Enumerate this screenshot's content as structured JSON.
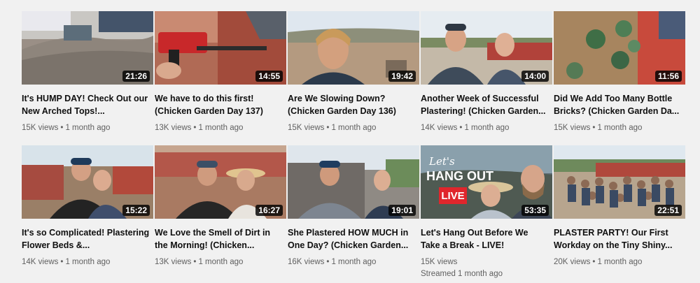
{
  "videos": [
    {
      "title": "It's HUMP DAY! Check Out our New Arched Tops!...",
      "duration": "21:26",
      "views": "15K views",
      "age": "1 month ago"
    },
    {
      "title": "We have to do this first! (Chicken Garden Day 137)",
      "duration": "14:55",
      "views": "13K views",
      "age": "1 month ago"
    },
    {
      "title": "Are We Slowing Down? (Chicken Garden Day 136)",
      "duration": "19:42",
      "views": "15K views",
      "age": "1 month ago"
    },
    {
      "title": "Another Week of Successful Plastering! (Chicken Garden...",
      "duration": "14:00",
      "views": "14K views",
      "age": "1 month ago"
    },
    {
      "title": "Did We Add Too Many Bottle Bricks? (Chicken Garden Da...",
      "duration": "11:56",
      "views": "15K views",
      "age": "1 month ago"
    },
    {
      "title": "It's so Complicated! Plastering Flower Beds &...",
      "duration": "15:22",
      "views": "14K views",
      "age": "1 month ago"
    },
    {
      "title": "We Love the Smell of Dirt in the Morning! (Chicken...",
      "duration": "16:27",
      "views": "13K views",
      "age": "1 month ago"
    },
    {
      "title": "She Plastered HOW MUCH in One Day? (Chicken Garden...",
      "duration": "19:01",
      "views": "16K views",
      "age": "1 month ago"
    },
    {
      "title": "Let's Hang Out Before We Take a Break - LIVE!",
      "duration": "53:35",
      "views": "15K views",
      "age": "Streamed 1 month ago",
      "thumb_text": {
        "line1": "Let's",
        "line2": "HANG OUT",
        "badge": "LIVE"
      }
    },
    {
      "title": "PLASTER PARTY! Our First Workday on the Tiny Shiny...",
      "duration": "22:51",
      "views": "20K views",
      "age": "1 month ago"
    }
  ],
  "separator": "•",
  "colors": {
    "live_badge": "#e0262c",
    "meta_text": "#606060",
    "background": "#f1f1f1"
  }
}
